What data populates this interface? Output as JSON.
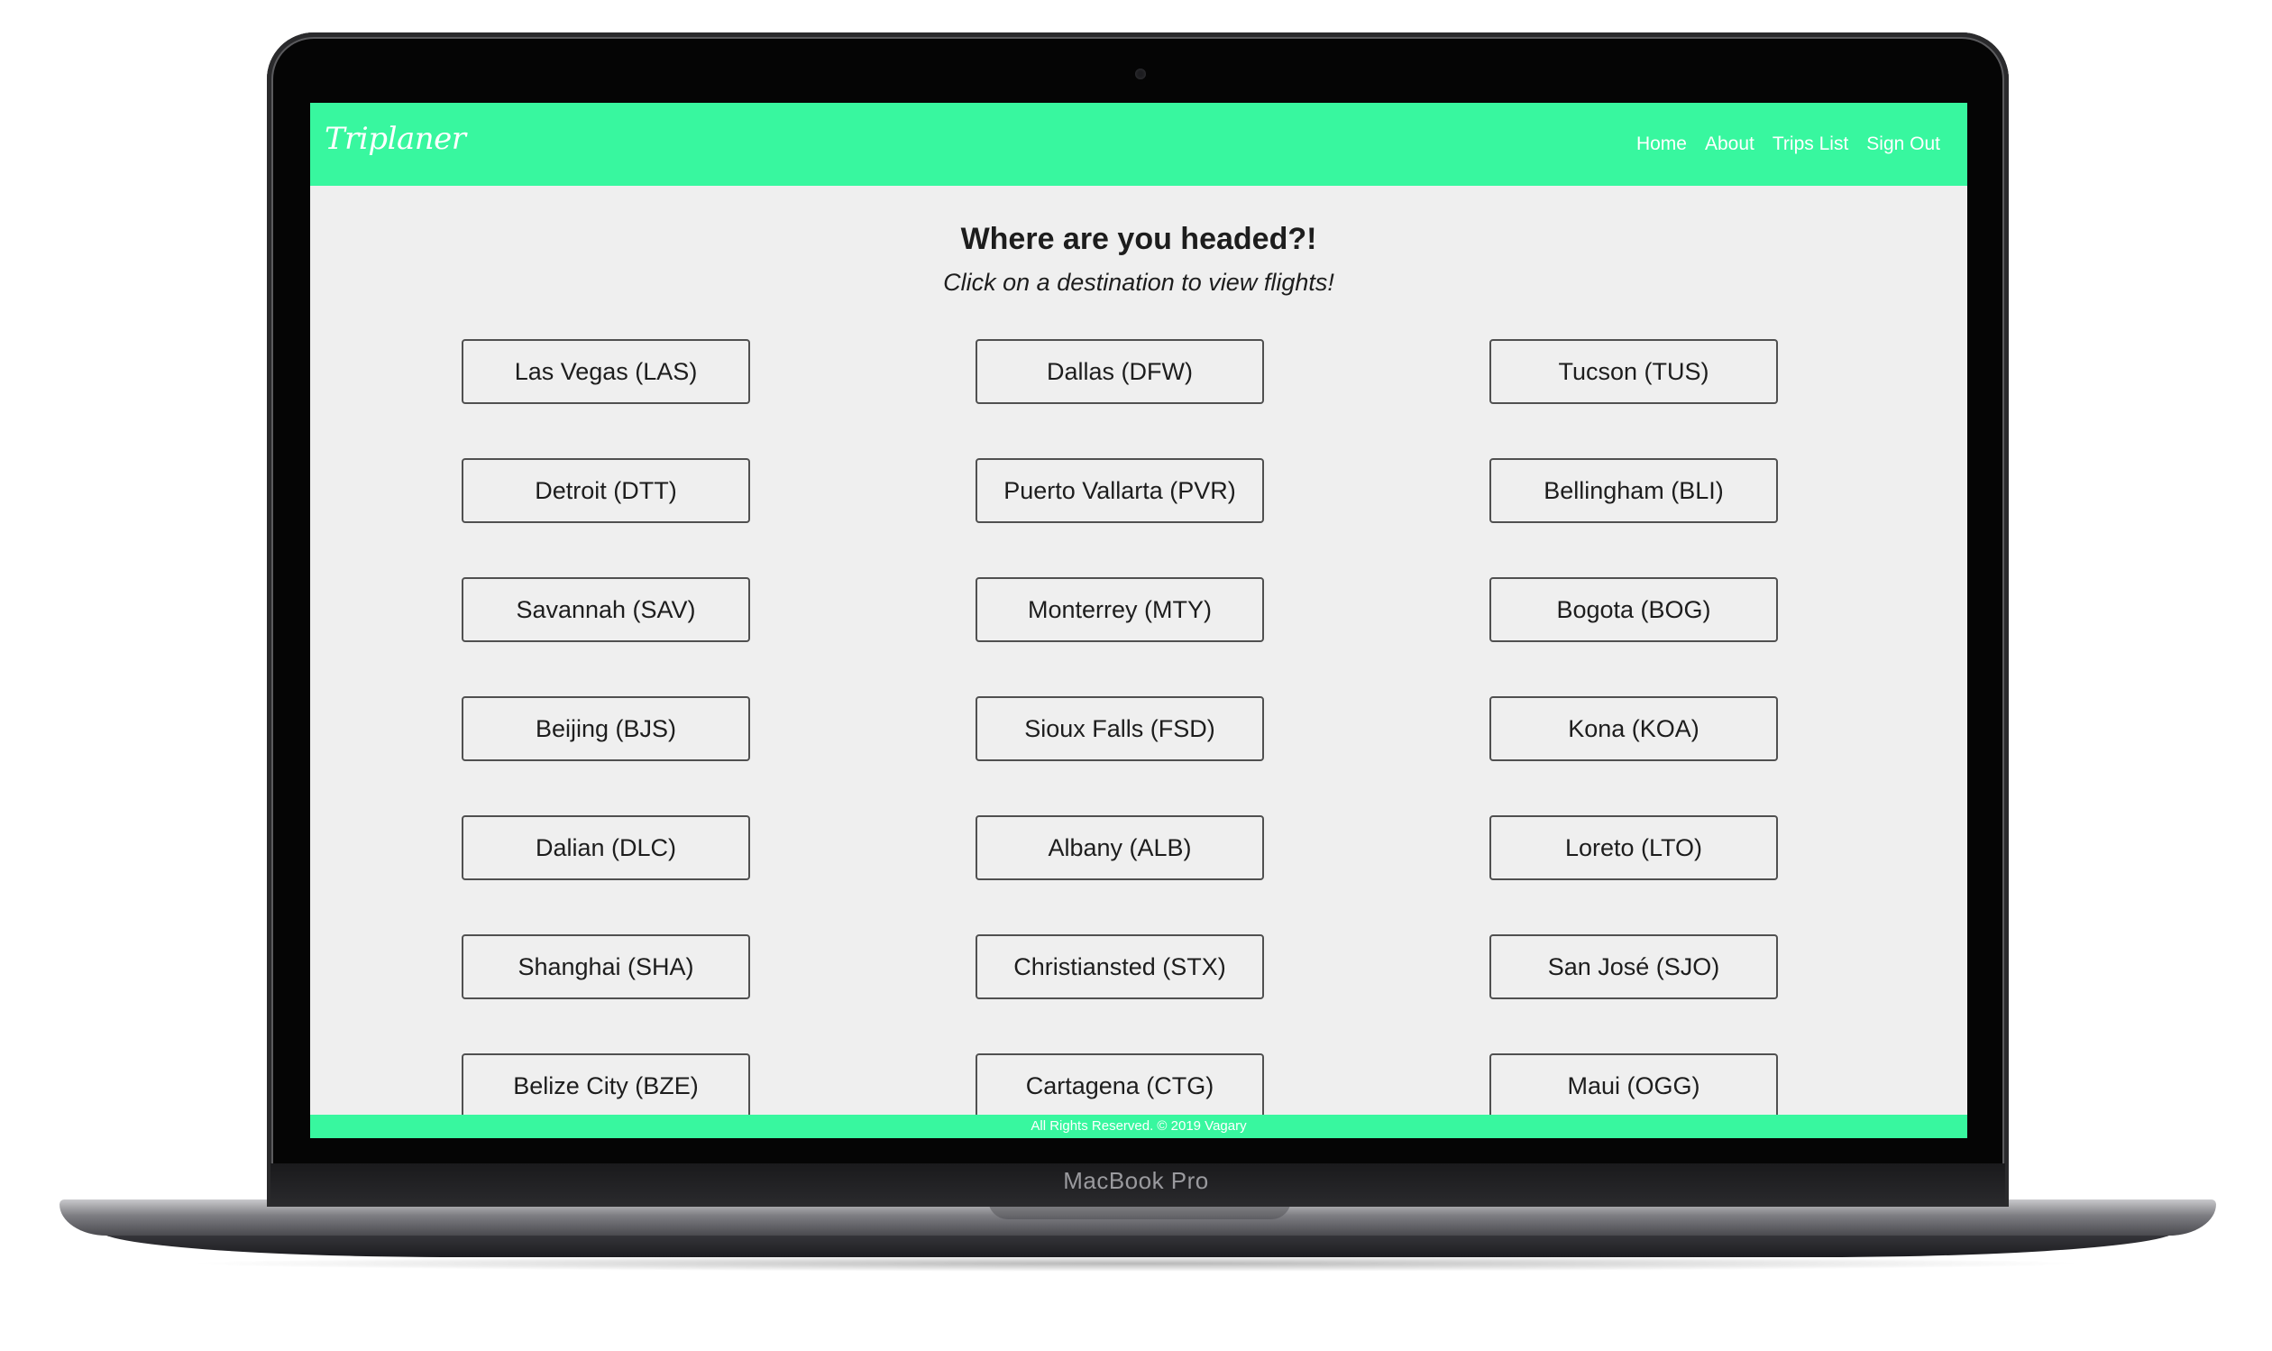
{
  "device": {
    "label": "MacBook Pro"
  },
  "navbar": {
    "logo": "Triplaner",
    "links": [
      "Home",
      "About",
      "Trips List",
      "Sign Out"
    ],
    "color": "#38f79f"
  },
  "main": {
    "heading": "Where are you headed?!",
    "subheading": "Click on a destination to view flights!",
    "destinations": [
      "Las Vegas (LAS)",
      "Dallas (DFW)",
      "Tucson (TUS)",
      "Detroit (DTT)",
      "Puerto Vallarta (PVR)",
      "Bellingham (BLI)",
      "Savannah (SAV)",
      "Monterrey (MTY)",
      "Bogota (BOG)",
      "Beijing (BJS)",
      "Sioux Falls (FSD)",
      "Kona (KOA)",
      "Dalian (DLC)",
      "Albany (ALB)",
      "Loreto (LTO)",
      "Shanghai (SHA)",
      "Christiansted (STX)",
      "San José (SJO)",
      "Belize City (BZE)",
      "Cartagena (CTG)",
      "Maui (OGG)"
    ]
  },
  "footer": {
    "text": "All Rights Reserved. © 2019 Vagary"
  }
}
